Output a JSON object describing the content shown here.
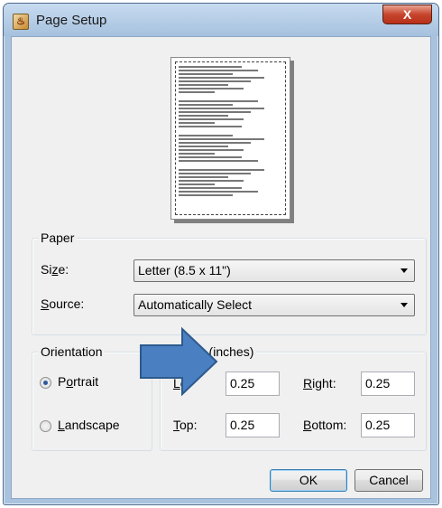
{
  "window": {
    "title": "Page Setup",
    "close_label": "X",
    "app_icon_glyph": "♨"
  },
  "paper": {
    "group_label": "Paper",
    "size_label_pre": "Si",
    "size_label_u": "z",
    "size_label_post": "e:",
    "size_value": "Letter (8.5 x 11\")",
    "source_label_u": "S",
    "source_label_post": "ource:",
    "source_value": "Automatically Select"
  },
  "orientation": {
    "group_label": "Orientation",
    "portrait_pre": "P",
    "portrait_u": "o",
    "portrait_post": "rtrait",
    "landscape_u": "L",
    "landscape_post": "andscape",
    "selected": "portrait"
  },
  "margins": {
    "group_label_visible": "M",
    "group_label_tail": "s (inches)",
    "left_label_u": "L",
    "left_label_post": "ef",
    "left_value": "0.25",
    "right_label_u": "R",
    "right_label_post": "ight:",
    "right_value": "0.25",
    "top_label_u": "T",
    "top_label_post": "op:",
    "top_value": "0.25",
    "bottom_label_u": "B",
    "bottom_label_post": "ottom:",
    "bottom_value": "0.25"
  },
  "buttons": {
    "ok": "OK",
    "cancel": "Cancel"
  },
  "colors": {
    "arrow_fill": "#4a7fc1",
    "arrow_stroke": "#2d5a8e"
  }
}
